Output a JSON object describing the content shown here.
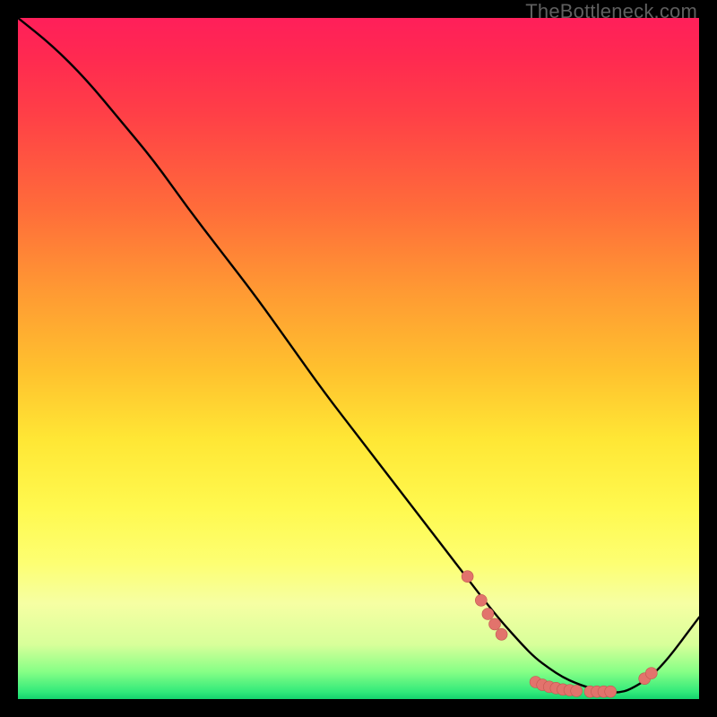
{
  "attribution": "TheBottleneck.com",
  "chart_data": {
    "type": "line",
    "title": "",
    "xlabel": "",
    "ylabel": "",
    "xlim": [
      0,
      100
    ],
    "ylim": [
      0,
      100
    ],
    "series": [
      {
        "name": "bottleneck-curve",
        "x": [
          0,
          5,
          10,
          15,
          20,
          25,
          30,
          35,
          40,
          45,
          50,
          55,
          60,
          65,
          70,
          74,
          76,
          78,
          80,
          82,
          84,
          86,
          88,
          90,
          94,
          100
        ],
        "y": [
          100,
          96,
          91,
          85,
          79,
          72,
          65.5,
          59,
          52,
          45,
          38.5,
          32,
          25.5,
          19,
          12.5,
          8,
          6,
          4.5,
          3.2,
          2.3,
          1.6,
          1.1,
          0.9,
          1.4,
          4,
          12
        ]
      }
    ],
    "markers": [
      {
        "x": 66,
        "y": 18
      },
      {
        "x": 68,
        "y": 14.5
      },
      {
        "x": 69,
        "y": 12.5
      },
      {
        "x": 70,
        "y": 11
      },
      {
        "x": 71,
        "y": 9.5
      },
      {
        "x": 76,
        "y": 2.5
      },
      {
        "x": 77,
        "y": 2.1
      },
      {
        "x": 78,
        "y": 1.8
      },
      {
        "x": 79,
        "y": 1.6
      },
      {
        "x": 80,
        "y": 1.4
      },
      {
        "x": 81,
        "y": 1.3
      },
      {
        "x": 82,
        "y": 1.2
      },
      {
        "x": 84,
        "y": 1.1
      },
      {
        "x": 85,
        "y": 1.1
      },
      {
        "x": 86,
        "y": 1.1
      },
      {
        "x": 87,
        "y": 1.1
      },
      {
        "x": 92,
        "y": 3.0
      },
      {
        "x": 93,
        "y": 3.8
      }
    ],
    "colors": {
      "curve": "#000000",
      "marker_fill": "#e2736c",
      "marker_stroke": "#c25750"
    }
  }
}
